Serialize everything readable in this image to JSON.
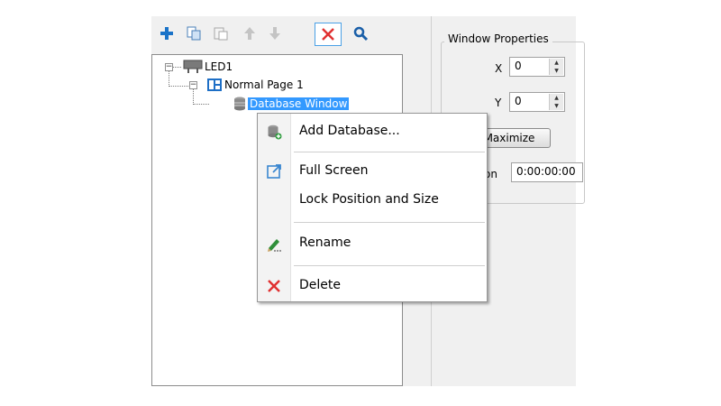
{
  "toolbar": {
    "buttons": [
      {
        "name": "add-icon"
      },
      {
        "name": "copy-icon"
      },
      {
        "name": "paste-icon"
      },
      {
        "name": "move-up-icon"
      },
      {
        "name": "move-down-icon"
      },
      {
        "name": "delete-icon"
      },
      {
        "name": "search-icon"
      }
    ]
  },
  "tree": {
    "root": {
      "label": "LED1",
      "expander": "−"
    },
    "page": {
      "label": "Normal Page 1",
      "expander": "−"
    },
    "window": {
      "label": "Database Window"
    }
  },
  "properties": {
    "group_title": "Window Properties",
    "x_label": "X",
    "x_value": "0",
    "y_label": "Y",
    "y_value": "0",
    "maximize_label": "Maximize",
    "duration_label_partial": "on",
    "duration_value": "0:00:00:00"
  },
  "context_menu": {
    "add_database": "Add Database...",
    "full_screen": "Full Screen",
    "lock_position": "Lock Position and Size",
    "rename": "Rename",
    "delete": "Delete"
  },
  "colors": {
    "accent": "#3399ff",
    "delete_red": "#e03030",
    "add_blue": "#1a73c8"
  }
}
